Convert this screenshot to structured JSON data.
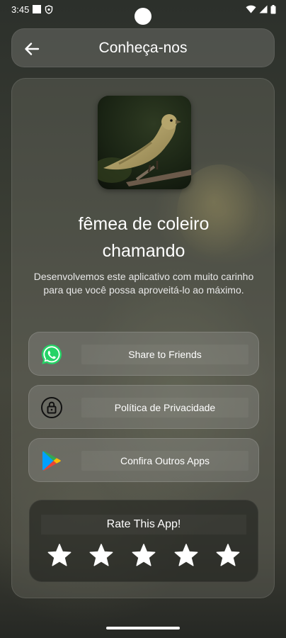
{
  "status_bar": {
    "time": "3:45"
  },
  "header": {
    "title": "Conheça-nos",
    "back_icon": "arrow-left-icon"
  },
  "app": {
    "name": "fêmea de coleiro chamando",
    "description": "Desenvolvemos este aplicativo com muito carinho para que você possa aproveitá-lo ao máximo.",
    "image_icon": "bird-photo"
  },
  "actions": [
    {
      "label": "Share to Friends",
      "icon": "whatsapp-icon",
      "color": "#25D366"
    },
    {
      "label": "Política de Privacidade",
      "icon": "lock-icon",
      "color": "#111111"
    },
    {
      "label": "Confira Outros Apps",
      "icon": "google-play-icon",
      "color": "#34A853"
    }
  ],
  "rating": {
    "title": "Rate This App!",
    "stars_total": 5,
    "stars_filled": 5,
    "star_color": "#ffffff"
  }
}
